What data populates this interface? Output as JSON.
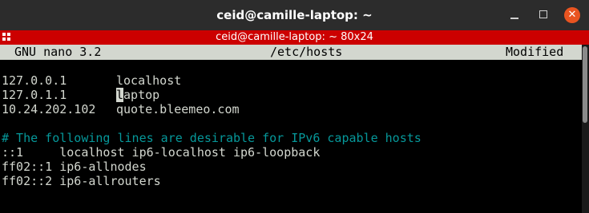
{
  "window": {
    "title": "ceid@camille-laptop: ~",
    "close_glyph": "✕"
  },
  "terminal": {
    "title": "ceid@camille-laptop: ~ 80x24"
  },
  "nano": {
    "version": "GNU nano 3.2",
    "filename": "/etc/hosts",
    "status": "Modified"
  },
  "hosts": [
    {
      "ip": "127.0.0.1",
      "name": "localhost"
    },
    {
      "ip": "127.0.1.1",
      "name_cursor": "l",
      "name_rest": "aptop"
    },
    {
      "ip": "10.24.202.102",
      "name": "quote.bleemeo.com"
    }
  ],
  "comment": "# The following lines are desirable for IPv6 capable hosts",
  "ipv6_lines": [
    "::1     localhost ip6-localhost ip6-loopback",
    "ff02::1 ip6-allnodes",
    "ff02::2 ip6-allrouters"
  ],
  "colors": {
    "titlebar": "#2c2c2c",
    "inner_titlebar": "#cc0000",
    "close_button": "#e95420",
    "nano_header": "#d3d7cf",
    "text": "#d3d7cf",
    "comment": "#06989a",
    "background": "#000000"
  }
}
